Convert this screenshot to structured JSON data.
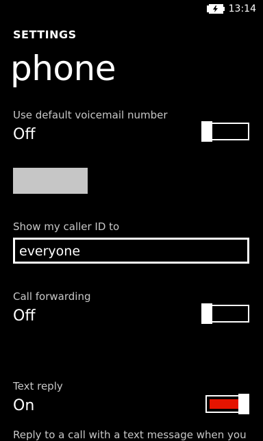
{
  "status_bar": {
    "time": "13:14",
    "battery_icon": "battery-charging-icon"
  },
  "header": {
    "app_title": "SETTINGS",
    "page_title": "phone"
  },
  "voicemail": {
    "label": "Use default voicemail number",
    "value": "Off",
    "toggle_on": false
  },
  "caller_id": {
    "label": "Show my caller ID to",
    "selected": "everyone"
  },
  "call_forwarding": {
    "label": "Call forwarding",
    "value": "Off",
    "toggle_on": false
  },
  "text_reply": {
    "label": "Text reply",
    "value": "On",
    "toggle_on": true,
    "accent_color": "#e51400",
    "description": "Reply to a call with a text message when you"
  }
}
